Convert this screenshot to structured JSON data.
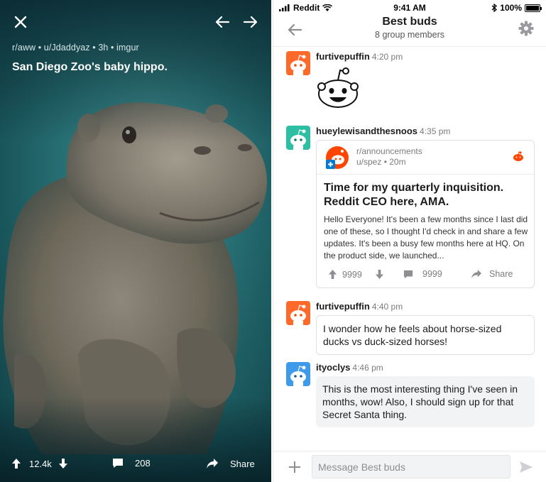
{
  "viewer": {
    "meta": "r/aww • u/Jdaddyaz • 3h • imgur",
    "title": "San Diego Zoo's baby hippo.",
    "upvotes": "12.4k",
    "comments": "208",
    "share_label": "Share"
  },
  "status_bar": {
    "carrier": "Reddit",
    "time": "9:41 AM",
    "battery": "100%"
  },
  "chat": {
    "title": "Best buds",
    "subtitle": "8 group members",
    "messages": [
      {
        "user": "furtivepuffin",
        "time": "4:20 pm",
        "kind": "sticker"
      },
      {
        "user": "hueylewisandthesnoos",
        "time": "4:35 pm",
        "kind": "post",
        "post": {
          "subreddit": "r/announcements",
          "author": "u/spez • 20m",
          "title": "Time for my quarterly inquisition. Reddit CEO here, AMA.",
          "body": "Hello Everyone! It's been a few months since I last did one of these, so I thought I'd check in and share a few updates. It's been a busy few months here at HQ. On the product side, we launched...",
          "upvotes": "9999",
          "comments": "9999",
          "share_label": "Share"
        }
      },
      {
        "user": "furtivepuffin",
        "time": "4:40 pm",
        "kind": "text",
        "text": "I wonder how he feels about horse-sized ducks vs duck-sized horses!"
      },
      {
        "user": "ityoclys",
        "time": "4:46 pm",
        "kind": "text",
        "text": "This is the most interesting thing I've seen in months, wow! Also, I should sign up for that Secret Santa thing."
      }
    ],
    "composer": {
      "placeholder": "Message Best buds"
    }
  },
  "colors": {
    "accent": "#ff4500",
    "blue": "#0079d3",
    "text": "#1c1c1c",
    "muted": "#7c7c7c"
  }
}
